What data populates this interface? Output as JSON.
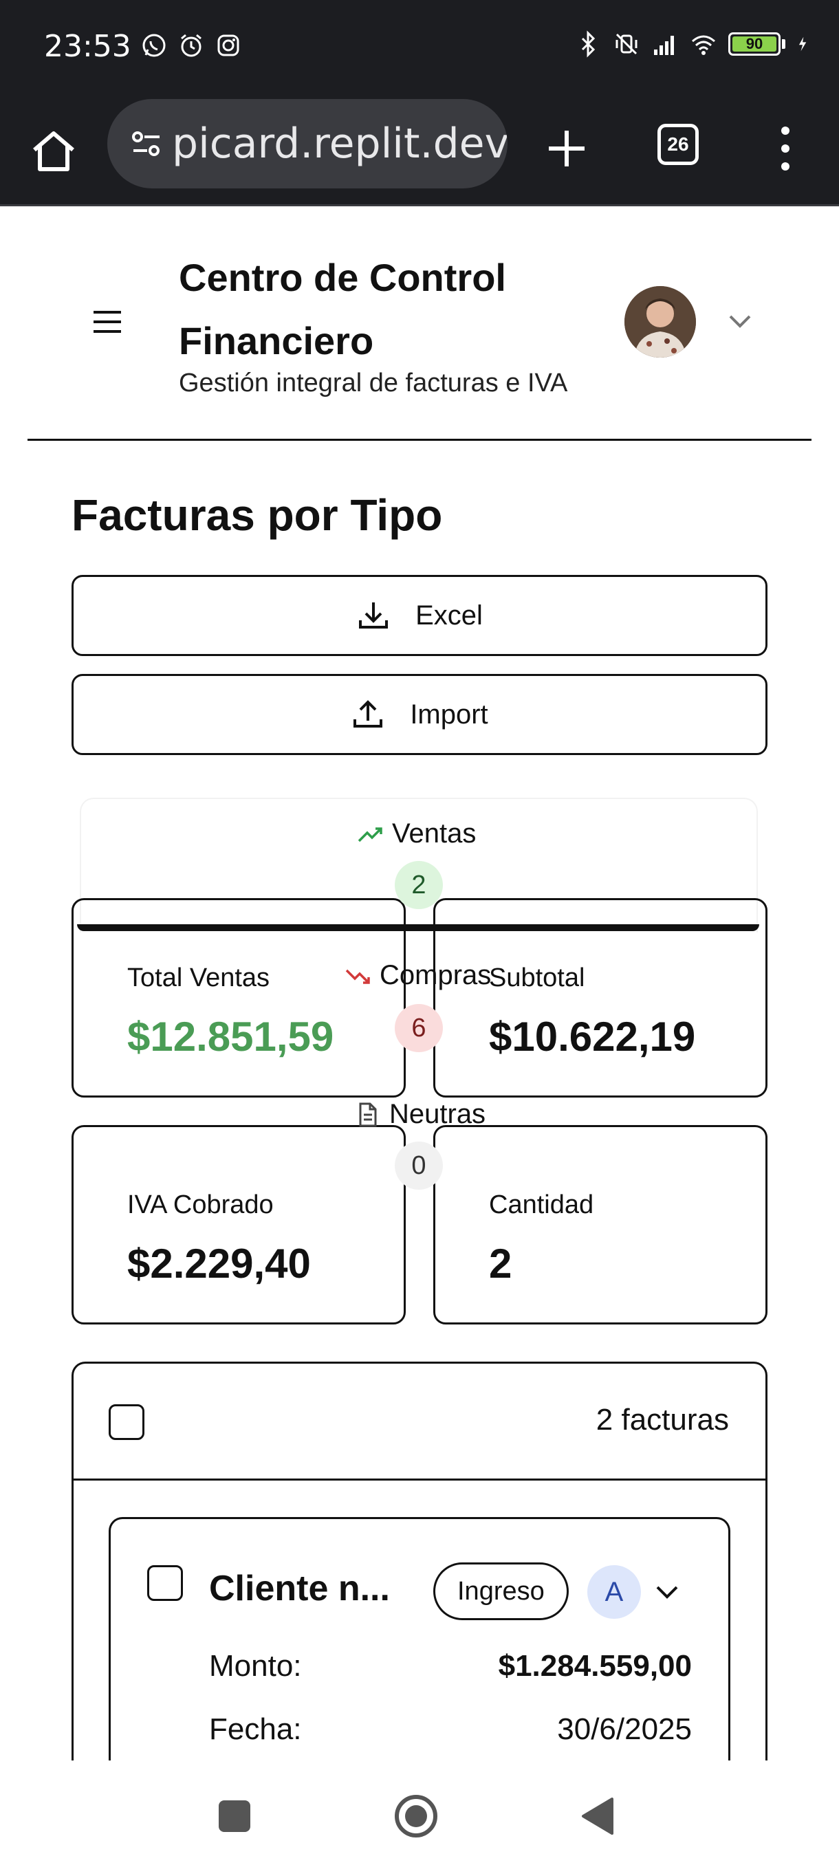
{
  "status_bar": {
    "time": "23:53",
    "left_icons": [
      "whatsapp-icon",
      "alarm-icon",
      "instagram-icon"
    ],
    "right_icons": [
      "bluetooth-icon",
      "vibrate-off-icon",
      "signal-icon",
      "wifi-icon",
      "battery-icon",
      "charging-icon"
    ],
    "battery_level": "90"
  },
  "browser": {
    "url": "picard.replit.dev",
    "tab_count": "26"
  },
  "header": {
    "title": "Centro de Control Financiero",
    "subtitle": "Gestión integral de facturas e IVA"
  },
  "section": {
    "title": "Facturas por Tipo",
    "excel_label": "Excel",
    "import_label": "Import"
  },
  "tabs": [
    {
      "label": "Ventas",
      "count": "2",
      "color": "#2e9e4a"
    },
    {
      "label": "Compras",
      "count": "6",
      "color": "#d23a3a"
    },
    {
      "label": "Neutras",
      "count": "0",
      "color": "#555555"
    }
  ],
  "stats": {
    "total_label": "Total Ventas",
    "total_value": "$12.851,59",
    "total_color": "#4a9c55",
    "subtotal_label": "Subtotal",
    "subtotal_value": "$10.622,19",
    "iva_label": "IVA Cobrado",
    "iva_value": "$2.229,40",
    "cantidad_label": "Cantidad",
    "cantidad_value": "2"
  },
  "invoice_list": {
    "count_text": "2 facturas",
    "items": [
      {
        "client": "Cliente n...",
        "type": "Ingreso",
        "letter": "A",
        "monto_label": "Monto:",
        "monto_value": "$1.284.559,00",
        "fecha_label": "Fecha:",
        "fecha_value": "30/6/2025"
      }
    ]
  }
}
